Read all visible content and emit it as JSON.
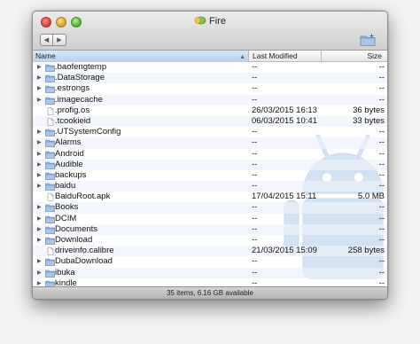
{
  "window": {
    "title": "Fire"
  },
  "toolbar": {
    "back_glyph": "◀",
    "forward_glyph": "▶"
  },
  "columns": {
    "name": "Name",
    "modified": "Last Modified",
    "size": "Size",
    "sort_glyph": "▲"
  },
  "rows": [
    {
      "name": ".baofengtemp",
      "modified": "--",
      "size": "--",
      "type": "folder",
      "expandable": true
    },
    {
      "name": ".DataStorage",
      "modified": "--",
      "size": "--",
      "type": "folder",
      "expandable": true
    },
    {
      "name": ".estrongs",
      "modified": "--",
      "size": "--",
      "type": "folder",
      "expandable": true
    },
    {
      "name": ".imagecache",
      "modified": "--",
      "size": "--",
      "type": "folder",
      "expandable": true
    },
    {
      "name": ".profig.os",
      "modified": "26/03/2015 16:13",
      "size": "36 bytes",
      "type": "file",
      "expandable": false
    },
    {
      "name": ".tcookieid",
      "modified": "06/03/2015 10:41",
      "size": "33 bytes",
      "type": "file",
      "expandable": false
    },
    {
      "name": ".UTSystemConfig",
      "modified": "--",
      "size": "--",
      "type": "folder",
      "expandable": true
    },
    {
      "name": "Alarms",
      "modified": "--",
      "size": "--",
      "type": "folder",
      "expandable": true
    },
    {
      "name": "Android",
      "modified": "--",
      "size": "--",
      "type": "folder",
      "expandable": true
    },
    {
      "name": "Audible",
      "modified": "--",
      "size": "--",
      "type": "folder",
      "expandable": true
    },
    {
      "name": "backups",
      "modified": "--",
      "size": "--",
      "type": "folder",
      "expandable": true
    },
    {
      "name": "baidu",
      "modified": "--",
      "size": "--",
      "type": "folder",
      "expandable": true
    },
    {
      "name": "BaiduRoot.apk",
      "modified": "17/04/2015 15:11",
      "size": "5.0 MB",
      "type": "file",
      "expandable": false
    },
    {
      "name": "Books",
      "modified": "--",
      "size": "--",
      "type": "folder",
      "expandable": true
    },
    {
      "name": "DCIM",
      "modified": "--",
      "size": "--",
      "type": "folder",
      "expandable": true
    },
    {
      "name": "Documents",
      "modified": "--",
      "size": "--",
      "type": "folder",
      "expandable": true
    },
    {
      "name": "Download",
      "modified": "--",
      "size": "--",
      "type": "folder",
      "expandable": true
    },
    {
      "name": "driveinfo.calibre",
      "modified": "21/03/2015 15:09",
      "size": "258 bytes",
      "type": "file",
      "expandable": false
    },
    {
      "name": "DubaDownload",
      "modified": "--",
      "size": "--",
      "type": "folder",
      "expandable": true
    },
    {
      "name": "ibuka",
      "modified": "--",
      "size": "--",
      "type": "folder",
      "expandable": true
    },
    {
      "name": "kindle",
      "modified": "--",
      "size": "--",
      "type": "folder",
      "expandable": true
    }
  ],
  "status": {
    "text": "35 items, 6.16 GB available"
  },
  "icons": {
    "folder": "folder-icon",
    "file": "file-icon",
    "disclosure": "disclosure-triangle-icon",
    "title": "android-bug-icon",
    "new_folder": "new-folder-icon",
    "watermark": "android-robot-watermark"
  },
  "colors": {
    "folder": "#7ea7d8",
    "header_sort": "#b7d1ed",
    "watermark": "#cfdff1"
  }
}
